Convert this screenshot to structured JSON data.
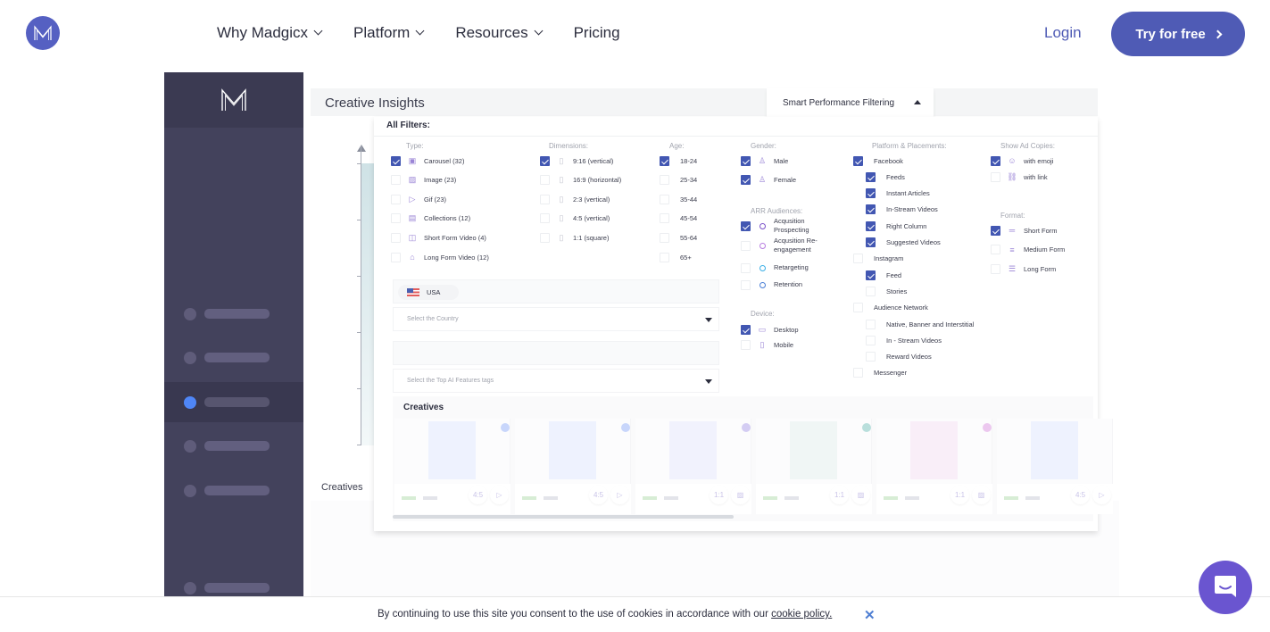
{
  "header": {
    "logo_icon": "madgicx-logo-icon",
    "nav": [
      {
        "label": "Why Madgicx",
        "has_dropdown": true
      },
      {
        "label": "Platform",
        "has_dropdown": true
      },
      {
        "label": "Resources",
        "has_dropdown": true
      },
      {
        "label": "Pricing",
        "has_dropdown": false
      }
    ],
    "login_label": "Login",
    "cta_label": "Try for free",
    "brand_color": "#4f5bb5"
  },
  "app": {
    "title": "Creative Insights",
    "bg_creatives_label": "Creatives",
    "filter_toggle_label": "Smart Performance Filtering",
    "sidebar_active_index": 2,
    "accent_color": "#4257b2"
  },
  "filters": {
    "title": "All Filters:",
    "type": {
      "label": "Type:",
      "options": [
        {
          "label": "Carousel (32)",
          "checked": true,
          "icon": "carousel-icon"
        },
        {
          "label": "Image (23)",
          "checked": false,
          "icon": "image-icon"
        },
        {
          "label": "Gif (23)",
          "checked": false,
          "icon": "play-icon"
        },
        {
          "label": "Collections (12)",
          "checked": false,
          "icon": "collections-icon"
        },
        {
          "label": "Short Form Video (4)",
          "checked": false,
          "icon": "video-icon"
        },
        {
          "label": "Long Form Video (12)",
          "checked": false,
          "icon": "camera-icon"
        }
      ]
    },
    "dimensions": {
      "label": "Dimensions:",
      "options": [
        {
          "label": "9:16 (vertical)",
          "checked": true
        },
        {
          "label": "16:9 (horizontal)",
          "checked": false
        },
        {
          "label": "2:3 (vertical)",
          "checked": false
        },
        {
          "label": "4:5 (vertical)",
          "checked": false
        },
        {
          "label": "1:1 (square)",
          "checked": false
        }
      ]
    },
    "age": {
      "label": "Age:",
      "options": [
        {
          "label": "18-24",
          "checked": true
        },
        {
          "label": "25-34",
          "checked": false
        },
        {
          "label": "35-44",
          "checked": false
        },
        {
          "label": "45-54",
          "checked": false
        },
        {
          "label": "55-64",
          "checked": false
        },
        {
          "label": "65+",
          "checked": false
        }
      ]
    },
    "gender": {
      "label": "Gender:",
      "options": [
        {
          "label": "Male",
          "checked": true
        },
        {
          "label": "Female",
          "checked": true
        }
      ]
    },
    "audiences": {
      "label": "ARR Audiences:",
      "options": [
        {
          "label": "Acqusition Prospecting",
          "checked": true,
          "color": "#7b52c9"
        },
        {
          "label": "Acqusition Re-engagement",
          "checked": false,
          "color": "#b77ce0"
        },
        {
          "label": "Retargeting",
          "checked": false,
          "color": "#3aaee6"
        },
        {
          "label": "Retention",
          "checked": false,
          "color": "#4a7fd6"
        }
      ]
    },
    "device": {
      "label": "Device:",
      "options": [
        {
          "label": "Desktop",
          "checked": true
        },
        {
          "label": "Mobile",
          "checked": false
        }
      ]
    },
    "platform": {
      "label": "Platform & Placements:",
      "options": [
        {
          "label": "Facebook",
          "checked": true,
          "indent": false
        },
        {
          "label": "Feeds",
          "checked": true,
          "indent": true
        },
        {
          "label": "Instant Articles",
          "checked": true,
          "indent": true
        },
        {
          "label": "In-Stream Videos",
          "checked": true,
          "indent": true
        },
        {
          "label": "Right Column",
          "checked": true,
          "indent": true
        },
        {
          "label": "Suggested Videos",
          "checked": true,
          "indent": true
        },
        {
          "label": "Instagram",
          "checked": false,
          "indent": false
        },
        {
          "label": "Feed",
          "checked": true,
          "indent": true
        },
        {
          "label": "Stories",
          "checked": false,
          "indent": true
        },
        {
          "label": "Audience Network",
          "checked": false,
          "indent": false
        },
        {
          "label": "Native, Banner and Interstitial",
          "checked": false,
          "indent": true
        },
        {
          "label": "In - Stream Videos",
          "checked": false,
          "indent": true
        },
        {
          "label": "Reward Videos",
          "checked": false,
          "indent": true
        },
        {
          "label": "Messenger",
          "checked": false,
          "indent": false
        }
      ]
    },
    "ad_copies": {
      "label": "Show Ad Copies:",
      "options": [
        {
          "label": "with emoji",
          "checked": true
        },
        {
          "label": "with link",
          "checked": false
        }
      ]
    },
    "format": {
      "label": "Format:",
      "options": [
        {
          "label": "Short Form",
          "checked": true
        },
        {
          "label": "Medium Form",
          "checked": false
        },
        {
          "label": "Long Form",
          "checked": false
        }
      ]
    },
    "country_chip": "USA",
    "country_placeholder": "Select the Country",
    "tags_placeholder": "Select the Top AI Features tags"
  },
  "creatives": {
    "title": "Creatives",
    "cards": [
      {
        "ratio": "4:5",
        "type": "video",
        "thumb_color": "#eef2fe",
        "dot_color": "#c8d6fb"
      },
      {
        "ratio": "4:5",
        "type": "video",
        "thumb_color": "#eef2fe",
        "dot_color": "#c8d6fb"
      },
      {
        "ratio": "1:1",
        "type": "image",
        "thumb_color": "#f1f2fd",
        "dot_color": "#d4cdf3"
      },
      {
        "ratio": "1:1",
        "type": "image",
        "thumb_color": "#f0f6f5",
        "dot_color": "#b9dfdc"
      },
      {
        "ratio": "1:1",
        "type": "image",
        "thumb_color": "#f9eef8",
        "dot_color": "#ecc8ef"
      },
      {
        "ratio": "4:5",
        "type": "video",
        "thumb_color": "#eef2fe",
        "dot_color": null
      }
    ]
  },
  "cookie": {
    "text": "By continuing to use this site you consent to the use of cookies in accordance with our ",
    "link": "cookie policy.",
    "close_icon": "close-icon"
  },
  "chat": {
    "icon": "chat-icon",
    "color": "#6a55d0"
  }
}
